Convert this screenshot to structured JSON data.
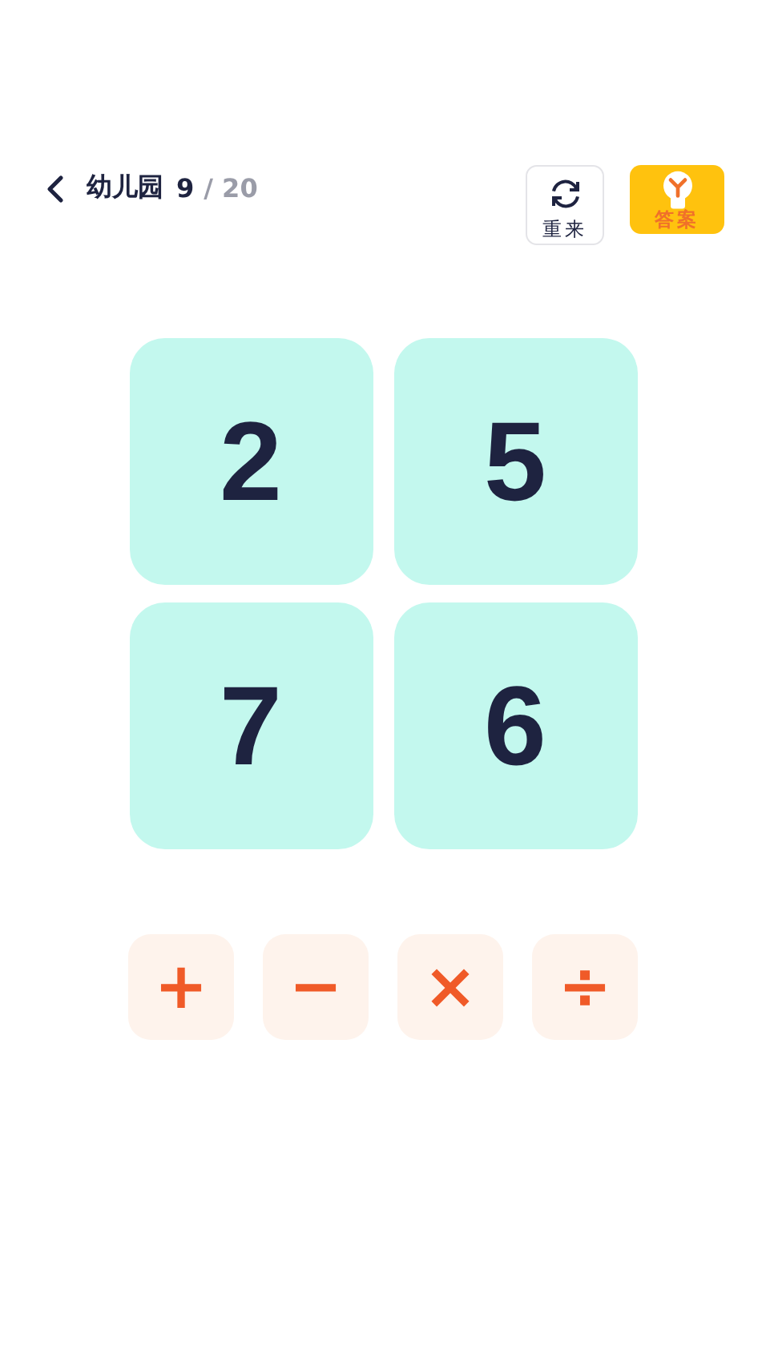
{
  "header": {
    "level_name": "幼儿园",
    "current": "9",
    "total": "/ 20"
  },
  "actions": [
    {
      "kind": "restart",
      "label": "重来"
    },
    {
      "kind": "answer",
      "label": "答案"
    }
  ],
  "cards": [
    {
      "value": "2"
    },
    {
      "value": "5"
    },
    {
      "value": "7"
    },
    {
      "value": "6"
    }
  ],
  "operators": [
    {
      "symbol": "+"
    },
    {
      "symbol": "−"
    },
    {
      "symbol": "×"
    },
    {
      "symbol": "÷"
    }
  ]
}
